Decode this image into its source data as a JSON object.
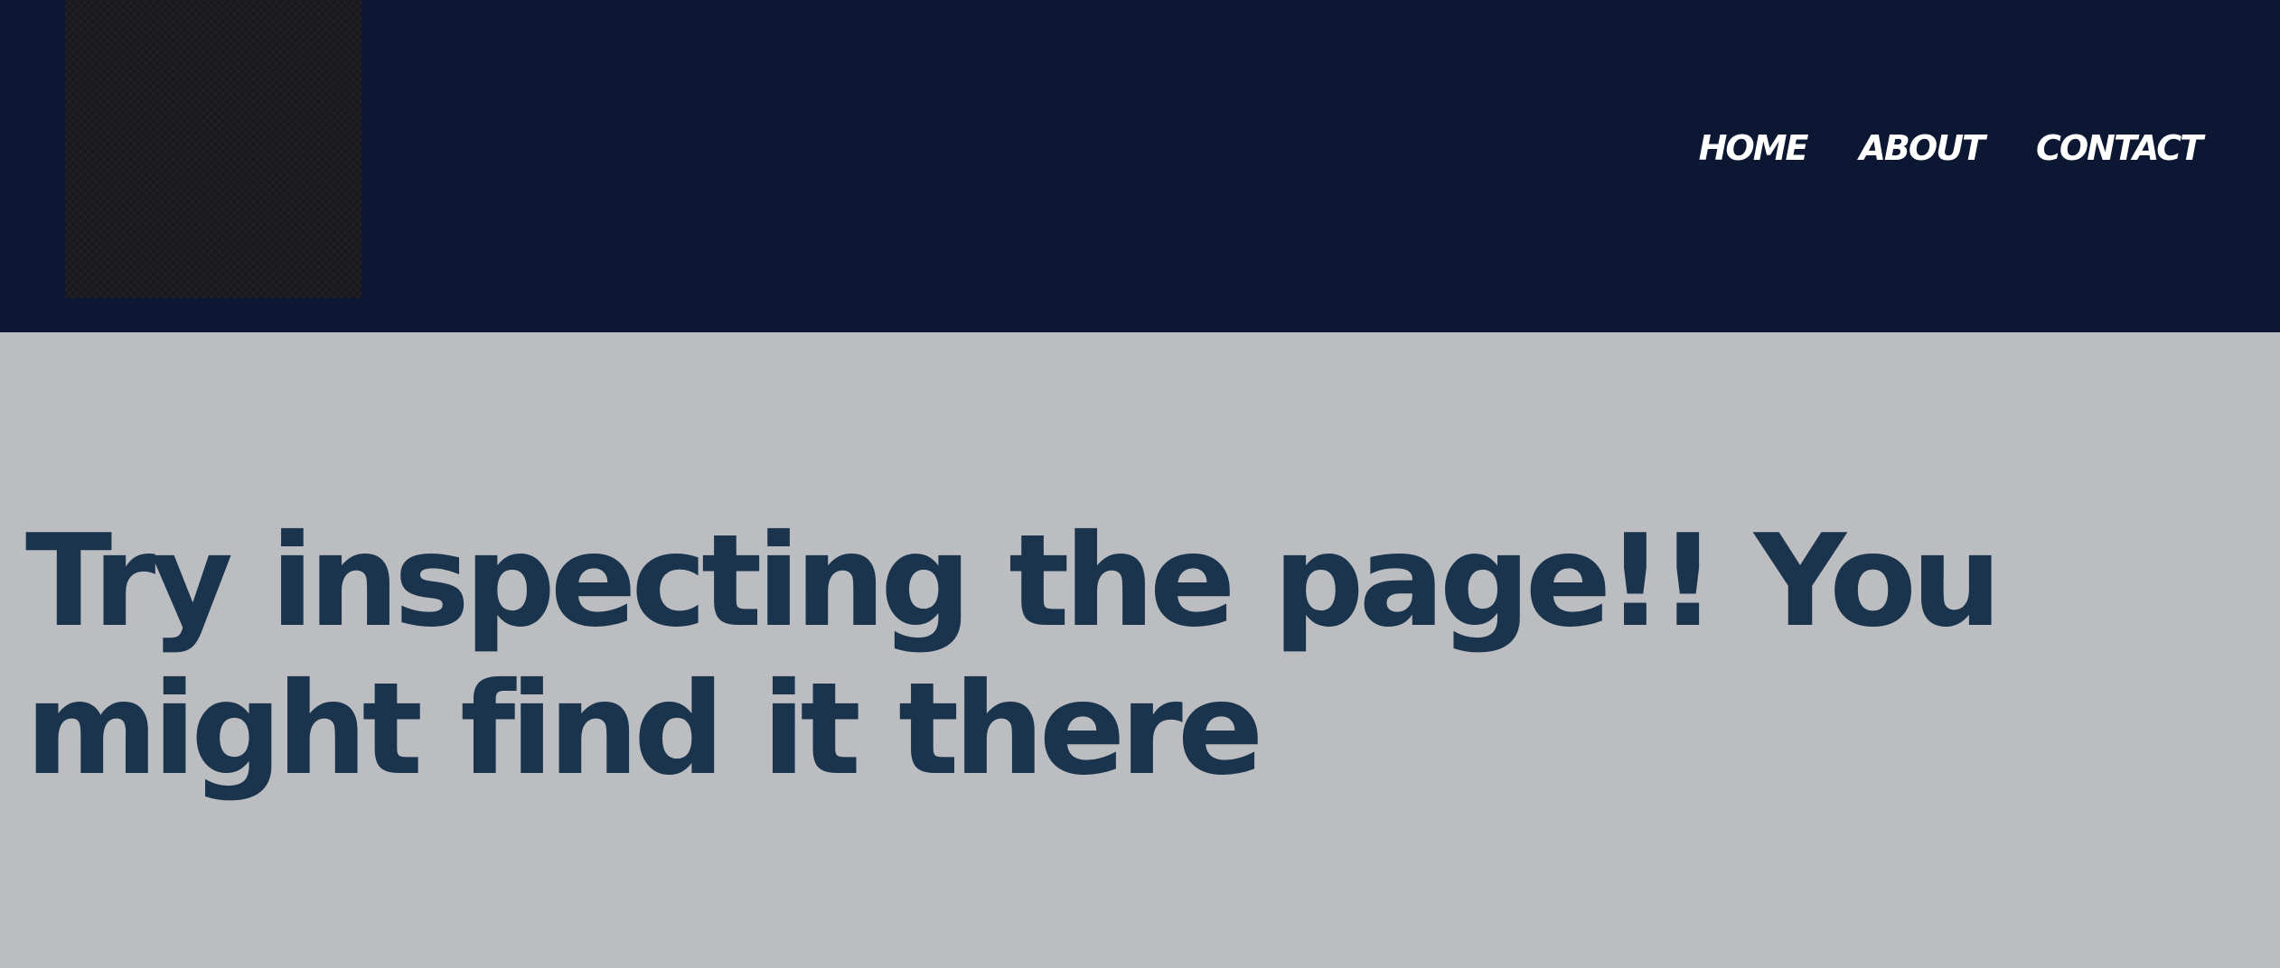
{
  "header": {
    "background_color": "#0c1733",
    "logo": {
      "icon": "dark-textured-square-logo",
      "color": "#1c1c1e"
    },
    "nav": [
      {
        "label": "HOME"
      },
      {
        "label": "ABOUT"
      },
      {
        "label": "CONTACT"
      }
    ]
  },
  "main": {
    "background_color": "#bcbdc1",
    "heading": "Try inspecting the page!! You might find it there",
    "heading_color": "#1b344d"
  }
}
